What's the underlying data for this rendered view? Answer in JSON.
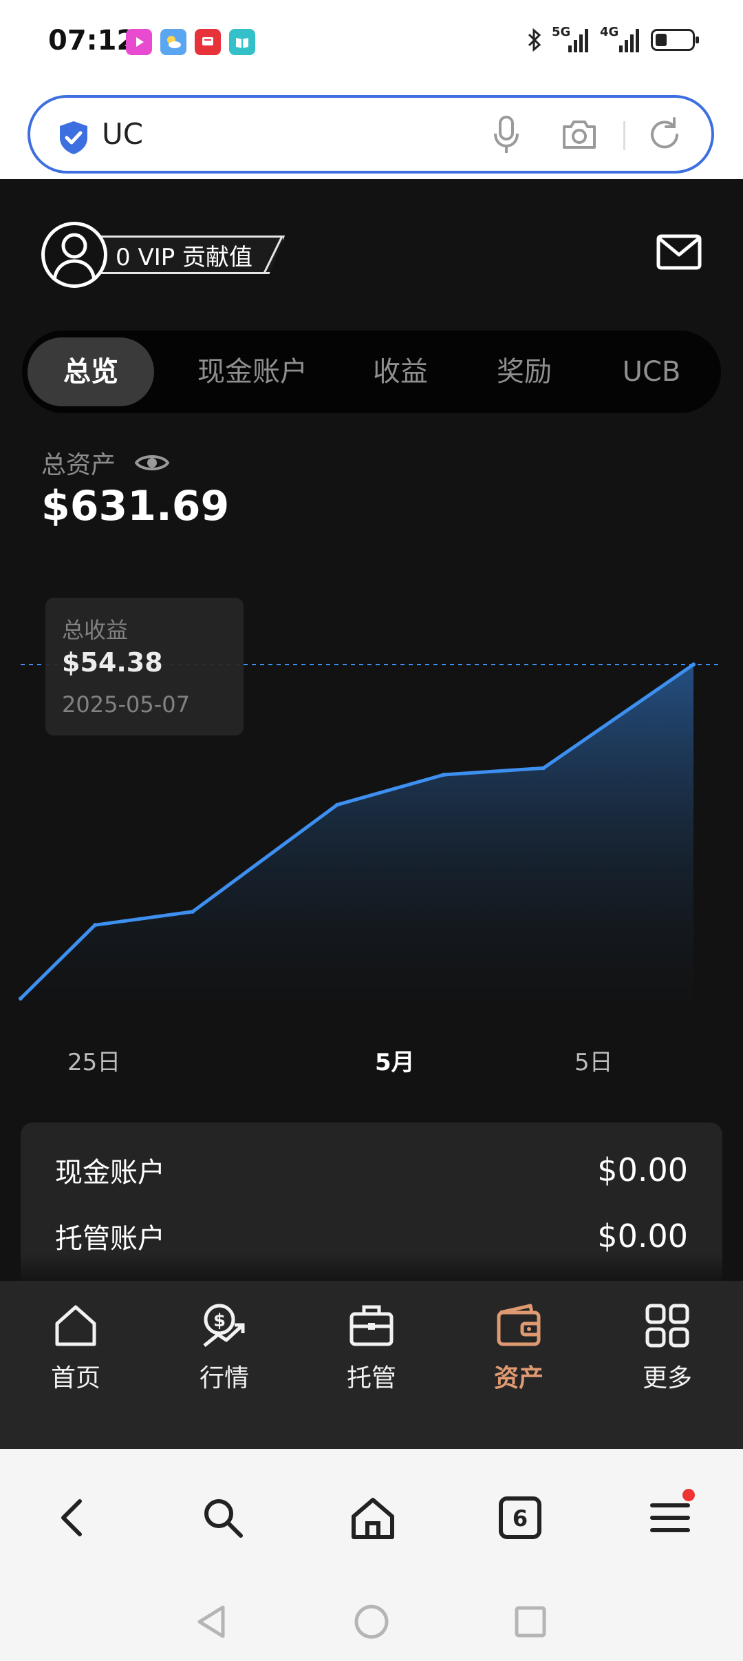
{
  "status_bar": {
    "time": "07:12",
    "network_1": "5G",
    "network_2": "4G"
  },
  "browser": {
    "url_text": "UC",
    "tabs_count": "6"
  },
  "header": {
    "vip_text": "0 VIP 贡献值"
  },
  "tabs": [
    {
      "label": "总览",
      "active": true
    },
    {
      "label": "现金账户",
      "active": false
    },
    {
      "label": "收益",
      "active": false
    },
    {
      "label": "奖励",
      "active": false
    },
    {
      "label": "UCB",
      "active": false
    }
  ],
  "total_assets": {
    "label": "总资产",
    "value": "$631.69"
  },
  "tooltip": {
    "label": "总收益",
    "value": "$54.38",
    "date": "2025-05-07"
  },
  "chart_data": {
    "type": "area",
    "x_ticks": [
      "25日",
      "5月",
      "5日"
    ],
    "series": [
      {
        "values": [
          0.0,
          0.22,
          0.26,
          0.58,
          0.67,
          0.69,
          1.0
        ]
      }
    ],
    "accent_color": "#3d8ff0"
  },
  "accounts": [
    {
      "name": "现金账户",
      "value": "$0.00"
    },
    {
      "name": "托管账户",
      "value": "$0.00"
    }
  ],
  "bottom_nav": [
    {
      "label": "首页",
      "icon": "home-icon",
      "active": false
    },
    {
      "label": "行情",
      "icon": "market-icon",
      "active": false
    },
    {
      "label": "托管",
      "icon": "briefcase-icon",
      "active": false
    },
    {
      "label": "资产",
      "icon": "wallet-icon",
      "active": true
    },
    {
      "label": "更多",
      "icon": "grid-icon",
      "active": false
    }
  ],
  "colors": {
    "accent": "#3d8ff0",
    "active_nav": "#e09a72",
    "background": "#121212"
  }
}
